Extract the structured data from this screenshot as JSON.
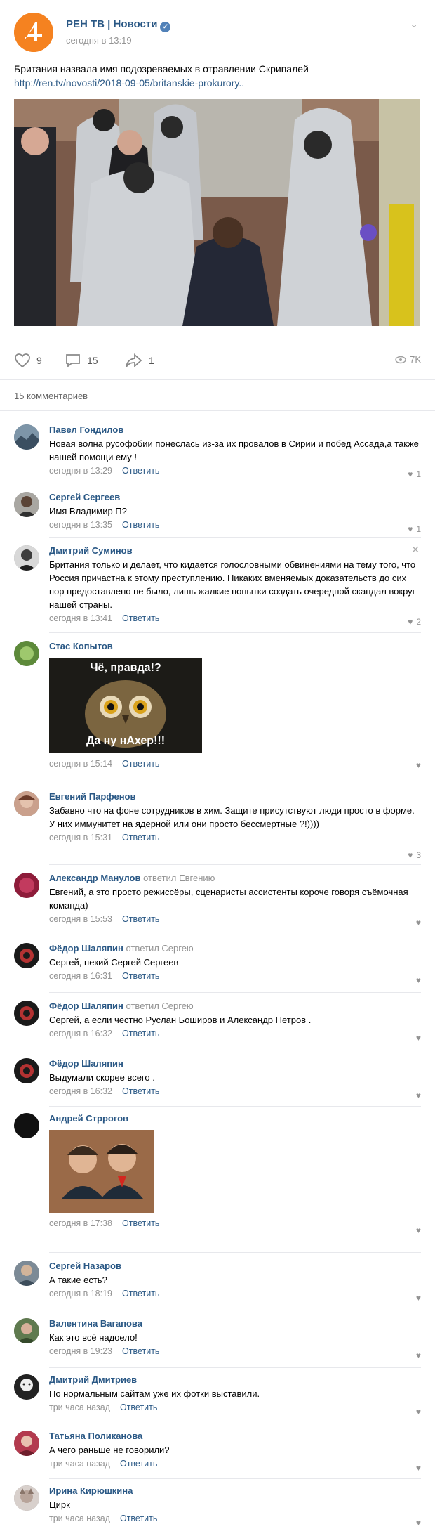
{
  "post": {
    "author": "РЕН ТВ | Новости",
    "time": "сегодня в 13:19",
    "text": "Британия назвала имя подозреваемых в отравлении Скрипалей",
    "link": "http://ren.tv/novosti/2018-09-05/britanskie-prokurory..",
    "likes": "9",
    "comments": "15",
    "shares": "1",
    "views": "7K",
    "menu_icon": "chevron-down-icon"
  },
  "comments_header": "15 комментариев",
  "answer_label": "Ответить",
  "comments": [
    {
      "name": "Павел Гондилов",
      "reply": "",
      "text": "Новая волна русофобии понеслась из-за их провалов в Сирии и побед Ассада,а также нашей помощи ему !",
      "time": "сегодня в 13:29",
      "likes": "1"
    },
    {
      "name": "Сергей Сергеев",
      "reply": "",
      "text": "Имя Владимир П?",
      "time": "сегодня в 13:35",
      "likes": "1"
    },
    {
      "name": "Дмитрий Суминов",
      "reply": "",
      "text": "Британия только и делает, что кидается голословными обвинениями на тему того, что Россия причастна к этому преступлению. Никаких вменяемых доказательств до сих пор предоставлено не было, лишь жалкие попытки создать очередной скандал вокруг нашей страны.",
      "time": "сегодня в 13:41",
      "likes": "2"
    },
    {
      "name": "Стас Копытов",
      "reply": "",
      "text": "",
      "time": "сегодня в 15:14",
      "likes": "",
      "image_top": "Чё, правда!?",
      "image_bottom": "Да ну нАхер!!!"
    },
    {
      "name": "Евгений Парфенов",
      "reply": "",
      "text": "Забавно что на фоне сотрудников в хим. Защите присутствуют люди просто в форме. У них иммунитет на ядерной или они просто бессмертные ?!))))",
      "time": "сегодня в 15:31",
      "likes": "3"
    },
    {
      "name": "Александр Манулов",
      "reply": "ответил Евгению",
      "text": "Евгений, а это просто режиссёры, сценаристы ассистенты короче говоря съёмочная команда)",
      "time": "сегодня в 15:53",
      "likes": ""
    },
    {
      "name": "Фёдор Шаляпин",
      "reply": "ответил Сергею",
      "text": "Сергей, некий Сергей Сергеев",
      "time": "сегодня в 16:31",
      "likes": ""
    },
    {
      "name": "Фёдор Шаляпин",
      "reply": "ответил Сергею",
      "text": "Сергей, а если честно Руслан Боширов и Александр Петров .",
      "time": "сегодня в 16:32",
      "likes": ""
    },
    {
      "name": "Фёдор Шаляпин",
      "reply": "",
      "text": "Выдумали скорее всего .",
      "time": "сегодня в 16:32",
      "likes": ""
    },
    {
      "name": "Андрей Стррогов",
      "reply": "",
      "text": "",
      "time": "сегодня в 17:38",
      "likes": ""
    },
    {
      "name": "Сергей Назаров",
      "reply": "",
      "text": "А такие есть?",
      "time": "сегодня в 18:19",
      "likes": ""
    },
    {
      "name": "Валентина Вагапова",
      "reply": "",
      "text": "Как это всё надоело!",
      "time": "сегодня в 19:23",
      "likes": ""
    },
    {
      "name": "Дмитрий Дмитриев",
      "reply": "",
      "text": "По нормальным сайтам уже их фотки выставили.",
      "time": "три часа назад",
      "likes": ""
    },
    {
      "name": "Татьяна Поликанова",
      "reply": "",
      "text": "А чего раньше не говорили?",
      "time": "три часа назад",
      "likes": ""
    },
    {
      "name": "Ирина Кирюшкина",
      "reply": "",
      "text": "Цирк",
      "time": "три часа назад",
      "likes": ""
    }
  ]
}
